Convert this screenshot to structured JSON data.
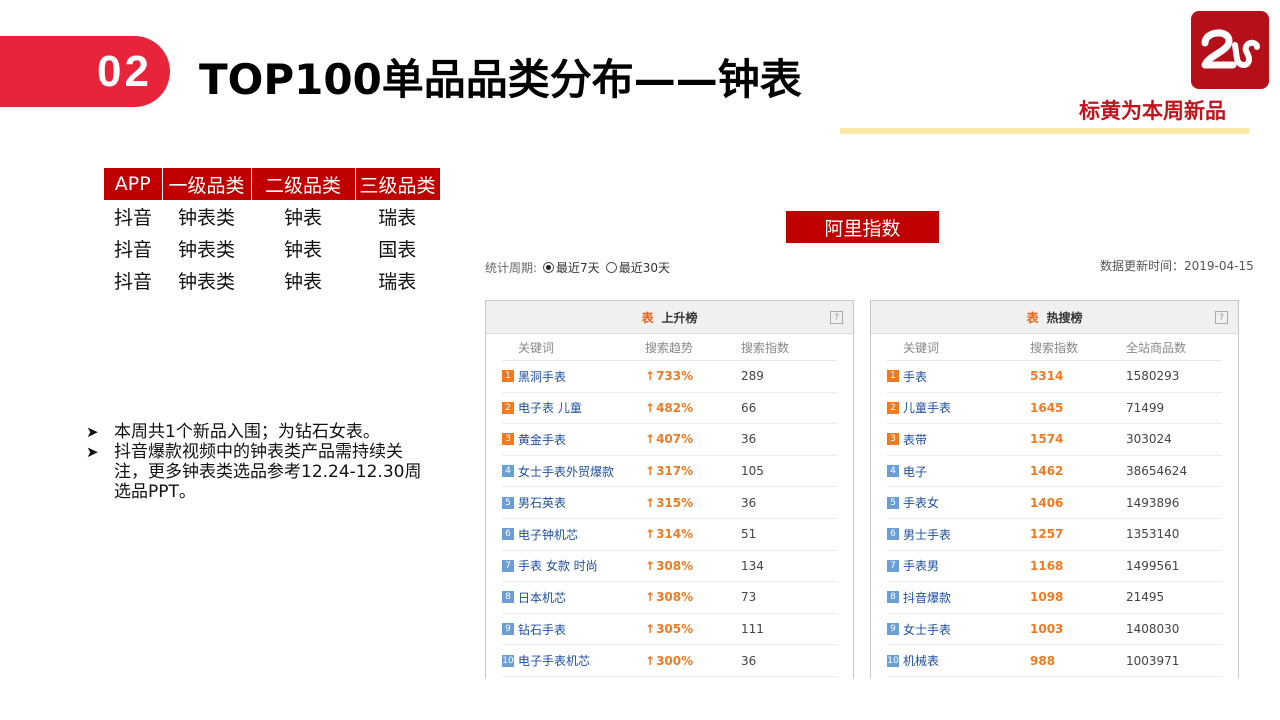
{
  "header": {
    "number": "02",
    "title": "TOP100单品品类分布——钟表",
    "note": "标黄为本周新品"
  },
  "category_table": {
    "headers": [
      "APP",
      "一级品类",
      "二级品类",
      "三级品类"
    ],
    "rows": [
      [
        "抖音",
        "钟表类",
        "钟表",
        "瑞表"
      ],
      [
        "抖音",
        "钟表类",
        "钟表",
        "国表"
      ],
      [
        "抖音",
        "钟表类",
        "钟表",
        "瑞表"
      ]
    ]
  },
  "notes": [
    "本周共1个新品入围；为钻石女表。",
    "抖音爆款视频中的钟表类产品需持续关注，更多钟表类选品参考12.24-12.30周选品PPT。"
  ],
  "ali": {
    "badge": "阿里指数",
    "period_label": "统计周期:",
    "period_options": [
      "最近7天",
      "最近30天"
    ],
    "period_selected": "最近7天",
    "update_text": "数据更新时间：2019-04-15",
    "rising": {
      "icon_text": "表",
      "title": "上升榜",
      "help": "?",
      "columns": [
        "关键词",
        "搜索趋势",
        "搜索指数"
      ],
      "rows": [
        {
          "rank": "1",
          "keyword": "黑洞手表",
          "trend": "733%",
          "index": "289"
        },
        {
          "rank": "2",
          "keyword": "电子表 儿童",
          "trend": "482%",
          "index": "66"
        },
        {
          "rank": "3",
          "keyword": "黄金手表",
          "trend": "407%",
          "index": "36"
        },
        {
          "rank": "4",
          "keyword": "女士手表外贸爆款",
          "trend": "317%",
          "index": "105"
        },
        {
          "rank": "5",
          "keyword": "男石英表",
          "trend": "315%",
          "index": "36"
        },
        {
          "rank": "6",
          "keyword": "电子钟机芯",
          "trend": "314%",
          "index": "51"
        },
        {
          "rank": "7",
          "keyword": "手表 女款 时尚",
          "trend": "308%",
          "index": "134"
        },
        {
          "rank": "8",
          "keyword": "日本机芯",
          "trend": "308%",
          "index": "73"
        },
        {
          "rank": "9",
          "keyword": "钻石手表",
          "trend": "305%",
          "index": "111"
        },
        {
          "rank": "10",
          "keyword": "电子手表机芯",
          "trend": "300%",
          "index": "36"
        }
      ]
    },
    "hot": {
      "icon_text": "表",
      "title": "热搜榜",
      "help": "?",
      "columns": [
        "关键词",
        "搜索指数",
        "全站商品数"
      ],
      "rows": [
        {
          "rank": "1",
          "keyword": "手表",
          "index": "5314",
          "count": "1580293"
        },
        {
          "rank": "2",
          "keyword": "儿童手表",
          "index": "1645",
          "count": "71499"
        },
        {
          "rank": "3",
          "keyword": "表带",
          "index": "1574",
          "count": "303024"
        },
        {
          "rank": "4",
          "keyword": "电子",
          "index": "1462",
          "count": "38654624"
        },
        {
          "rank": "5",
          "keyword": "手表女",
          "index": "1406",
          "count": "1493896"
        },
        {
          "rank": "6",
          "keyword": "男士手表",
          "index": "1257",
          "count": "1353140"
        },
        {
          "rank": "7",
          "keyword": "手表男",
          "index": "1168",
          "count": "1499561"
        },
        {
          "rank": "8",
          "keyword": "抖音爆款",
          "index": "1098",
          "count": "21495"
        },
        {
          "rank": "9",
          "keyword": "女士手表",
          "index": "1003",
          "count": "1408030"
        },
        {
          "rank": "10",
          "keyword": "机械表",
          "index": "988",
          "count": "1003971"
        }
      ]
    }
  }
}
